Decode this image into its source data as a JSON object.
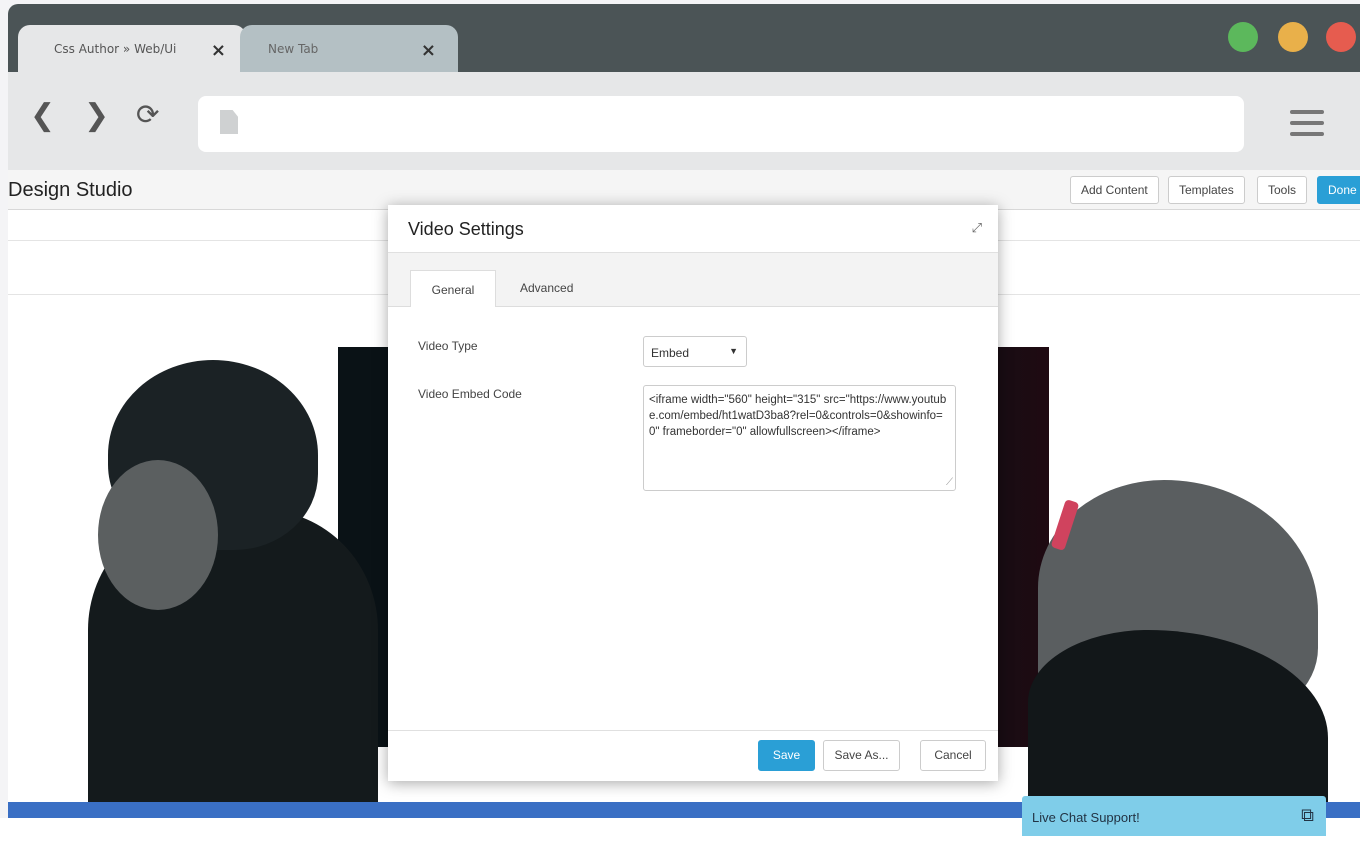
{
  "browser": {
    "tabs": [
      {
        "label": "Css Author » Web/Ui",
        "close": "×"
      },
      {
        "label": "New Tab",
        "close": "×"
      }
    ],
    "nav": {
      "back": "❮",
      "forward": "❯",
      "reload": "⟳"
    },
    "url": "",
    "window_controls": {
      "green": "#5cb85c",
      "yellow": "#e9b04a",
      "red": "#e65c4f"
    }
  },
  "app": {
    "title": "Design Studio",
    "toolbar": {
      "add_content": "Add Content",
      "templates": "Templates",
      "tools": "Tools",
      "done": "Done"
    },
    "accent_color": "#2a9fd6"
  },
  "modal": {
    "title": "Video Settings",
    "tabs": [
      {
        "label": "General",
        "active": true
      },
      {
        "label": "Advanced",
        "active": false
      }
    ],
    "fields": {
      "video_type_label": "Video Type",
      "video_type_value": "Embed",
      "embed_code_label": "Video Embed Code",
      "embed_code_value": "<iframe width=\"560\" height=\"315\" src=\"https://www.youtube.com/embed/ht1watD3ba8?rel=0&controls=0&showinfo=0\" frameborder=\"0\" allowfullscreen></iframe>"
    },
    "footer": {
      "save": "Save",
      "save_as": "Save As...",
      "cancel": "Cancel"
    }
  },
  "live_chat": {
    "label": "Live Chat Support!"
  }
}
